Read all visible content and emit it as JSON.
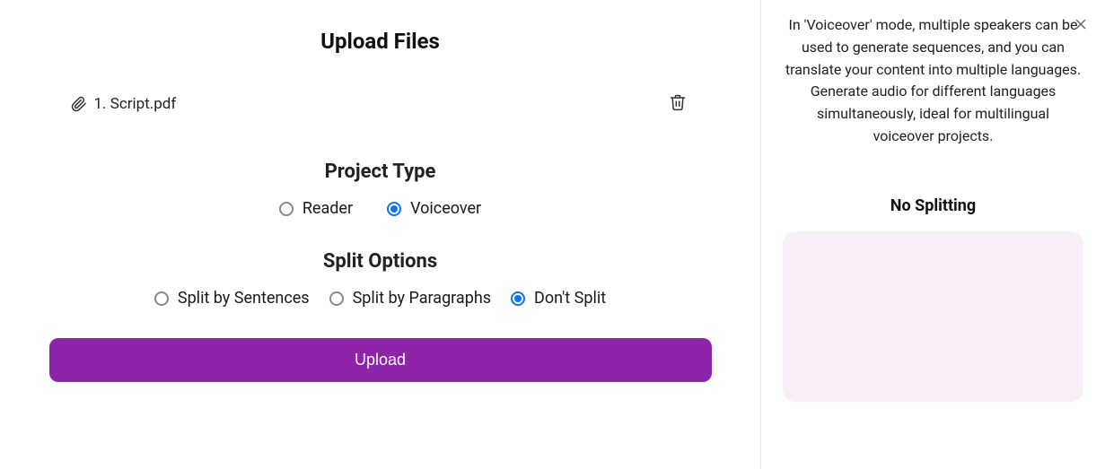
{
  "header": {
    "title": "Upload Files"
  },
  "file": {
    "label": "1. Script.pdf"
  },
  "projectType": {
    "title": "Project Type",
    "options": {
      "reader": "Reader",
      "voiceover": "Voiceover"
    },
    "selected": "voiceover"
  },
  "splitOptions": {
    "title": "Split Options",
    "options": {
      "sentences": "Split by Sentences",
      "paragraphs": "Split by Paragraphs",
      "none": "Don't Split"
    },
    "selected": "none"
  },
  "uploadButton": {
    "label": "Upload"
  },
  "sidebar": {
    "description": "In 'Voiceover' mode, multiple speakers can be used to generate sequences, and you can translate your content into multiple languages. Generate audio for different languages simultaneously, ideal for multilingual voiceover projects.",
    "subtitle": "No Splitting"
  }
}
